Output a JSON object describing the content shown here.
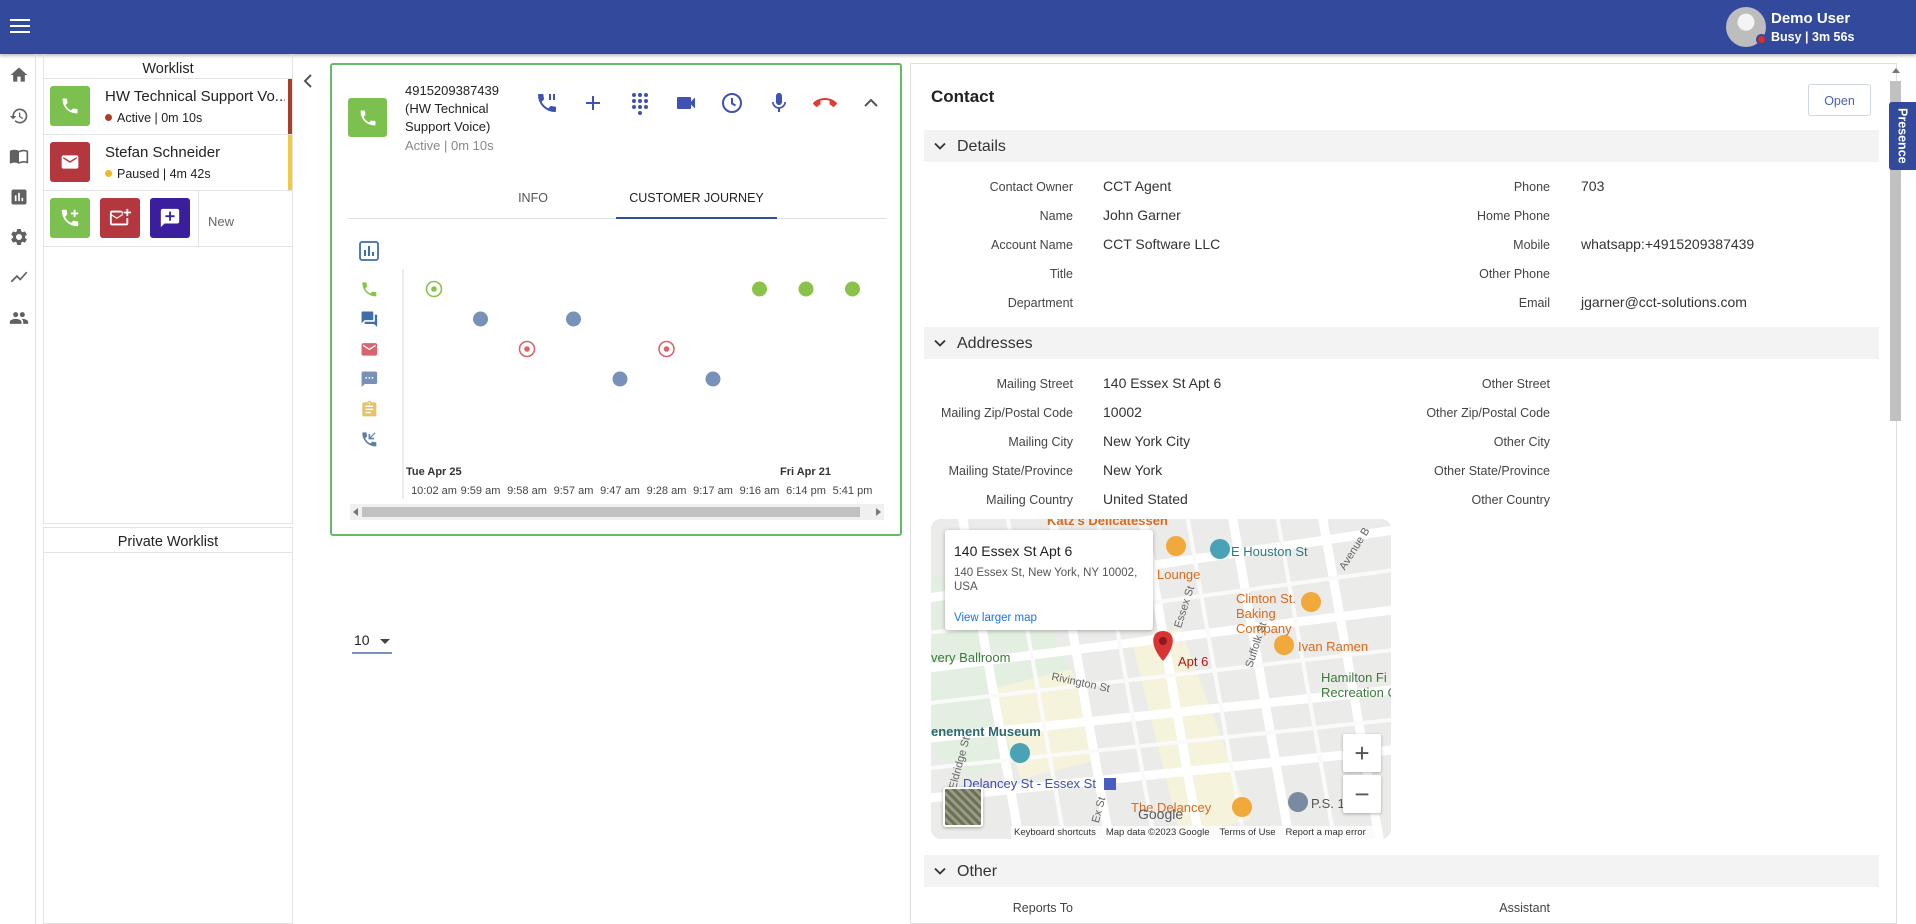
{
  "user": {
    "name": "Demo User",
    "status": "Busy | 3m 56s"
  },
  "worklist": {
    "title": "Worklist",
    "items": [
      {
        "name": "HW Technical Support Vo...",
        "status": "Active | 0m 10s"
      },
      {
        "name": "Stefan Schneider",
        "status": "Paused | 4m 42s"
      }
    ],
    "new_label": "New"
  },
  "private_worklist": {
    "title": "Private Worklist"
  },
  "call": {
    "number": "4915209387439",
    "queue": "(HW Technical Support Voice)",
    "status": "Active | 0m 10s",
    "tabs": [
      "INFO",
      "CUSTOMER JOURNEY"
    ],
    "active_tab": "CUSTOMER JOURNEY"
  },
  "journey": {
    "page_size": "10",
    "channels": [
      "phone-icon",
      "chat-icon",
      "email-icon",
      "message-icon",
      "task-icon",
      "callback-icon"
    ],
    "date_labels": [
      "Tue Apr 25",
      "Fri Apr 21"
    ],
    "time_labels": [
      "10:02 am",
      "9:59 am",
      "9:58 am",
      "9:57 am",
      "9:47 am",
      "9:28 am",
      "9:17 am",
      "9:16 am",
      "6:14 pm",
      "5:41 pm"
    ],
    "events": [
      {
        "time": "10:02 am",
        "channel": "phone",
        "kind": "target",
        "color": "#8bc34a"
      },
      {
        "time": "9:59 am",
        "channel": "chat",
        "kind": "dot",
        "color": "#7891b8"
      },
      {
        "time": "9:58 am",
        "channel": "email",
        "kind": "target",
        "color": "#d9646e"
      },
      {
        "time": "9:57 am",
        "channel": "chat",
        "kind": "dot",
        "color": "#7891b8"
      },
      {
        "time": "9:47 am",
        "channel": "message",
        "kind": "dot",
        "color": "#7891b8"
      },
      {
        "time": "9:28 am",
        "channel": "email",
        "kind": "target",
        "color": "#d9646e"
      },
      {
        "time": "9:17 am",
        "channel": "message",
        "kind": "dot",
        "color": "#7891b8"
      },
      {
        "time": "9:16 am",
        "channel": "phone",
        "kind": "dot",
        "color": "#8bc34a"
      },
      {
        "time": "6:14 pm",
        "channel": "phone",
        "kind": "dot",
        "color": "#8bc34a"
      },
      {
        "time": "5:41 pm",
        "channel": "phone",
        "kind": "dot",
        "color": "#8bc34a"
      }
    ]
  },
  "contact": {
    "title": "Contact",
    "open_label": "Open",
    "sections": {
      "details": "Details",
      "addresses": "Addresses",
      "other": "Other"
    },
    "details_left": [
      {
        "label": "Contact Owner",
        "value": "CCT Agent"
      },
      {
        "label": "Name",
        "value": "John Garner"
      },
      {
        "label": "Account Name",
        "value": "CCT Software LLC"
      },
      {
        "label": "Title",
        "value": ""
      },
      {
        "label": "Department",
        "value": ""
      }
    ],
    "details_right": [
      {
        "label": "Phone",
        "value": "703"
      },
      {
        "label": "Home Phone",
        "value": ""
      },
      {
        "label": "Mobile",
        "value": "whatsapp:+4915209387439"
      },
      {
        "label": "Other Phone",
        "value": ""
      },
      {
        "label": "Email",
        "value": "jgarner@cct-solutions.com"
      }
    ],
    "addr_left": [
      {
        "label": "Mailing Street",
        "value": "140 Essex St Apt 6"
      },
      {
        "label": "Mailing Zip/Postal Code",
        "value": "10002"
      },
      {
        "label": "Mailing City",
        "value": "New York City"
      },
      {
        "label": "Mailing State/Province",
        "value": "New York"
      },
      {
        "label": "Mailing Country",
        "value": "United Stated"
      }
    ],
    "addr_right": [
      {
        "label": "Other Street",
        "value": ""
      },
      {
        "label": "Other Zip/Postal Code",
        "value": ""
      },
      {
        "label": "Other City",
        "value": ""
      },
      {
        "label": "Other State/Province",
        "value": ""
      },
      {
        "label": "Other Country",
        "value": ""
      }
    ],
    "other_left": {
      "label": "Reports To"
    },
    "other_right": {
      "label": "Assistant"
    }
  },
  "map": {
    "popup_title": "140 Essex St Apt 6",
    "popup_address": "140 Essex St, New York, NY 10002, USA",
    "popup_link": "View larger map",
    "pin_label": "Apt 6",
    "places": [
      "Katz's Delicatessen",
      "E Houston St",
      "Lounge",
      "Avenue B",
      "Clinton St. Baking Company",
      "Essex St",
      "Suffolk St",
      "Ivan Ramen",
      "very Ballroom",
      "Rivington St",
      "Hamilton Fi",
      "Recreation Cent",
      "enement Museum",
      "Eldridge St",
      "Delancey St - Essex St",
      "Ex St",
      "The Delancey",
      "P.S. 1",
      "Google"
    ],
    "footer": [
      "Keyboard shortcuts",
      "Map data ©2023 Google",
      "Terms of Use",
      "Report a map error"
    ]
  },
  "presence_label": "Presence"
}
